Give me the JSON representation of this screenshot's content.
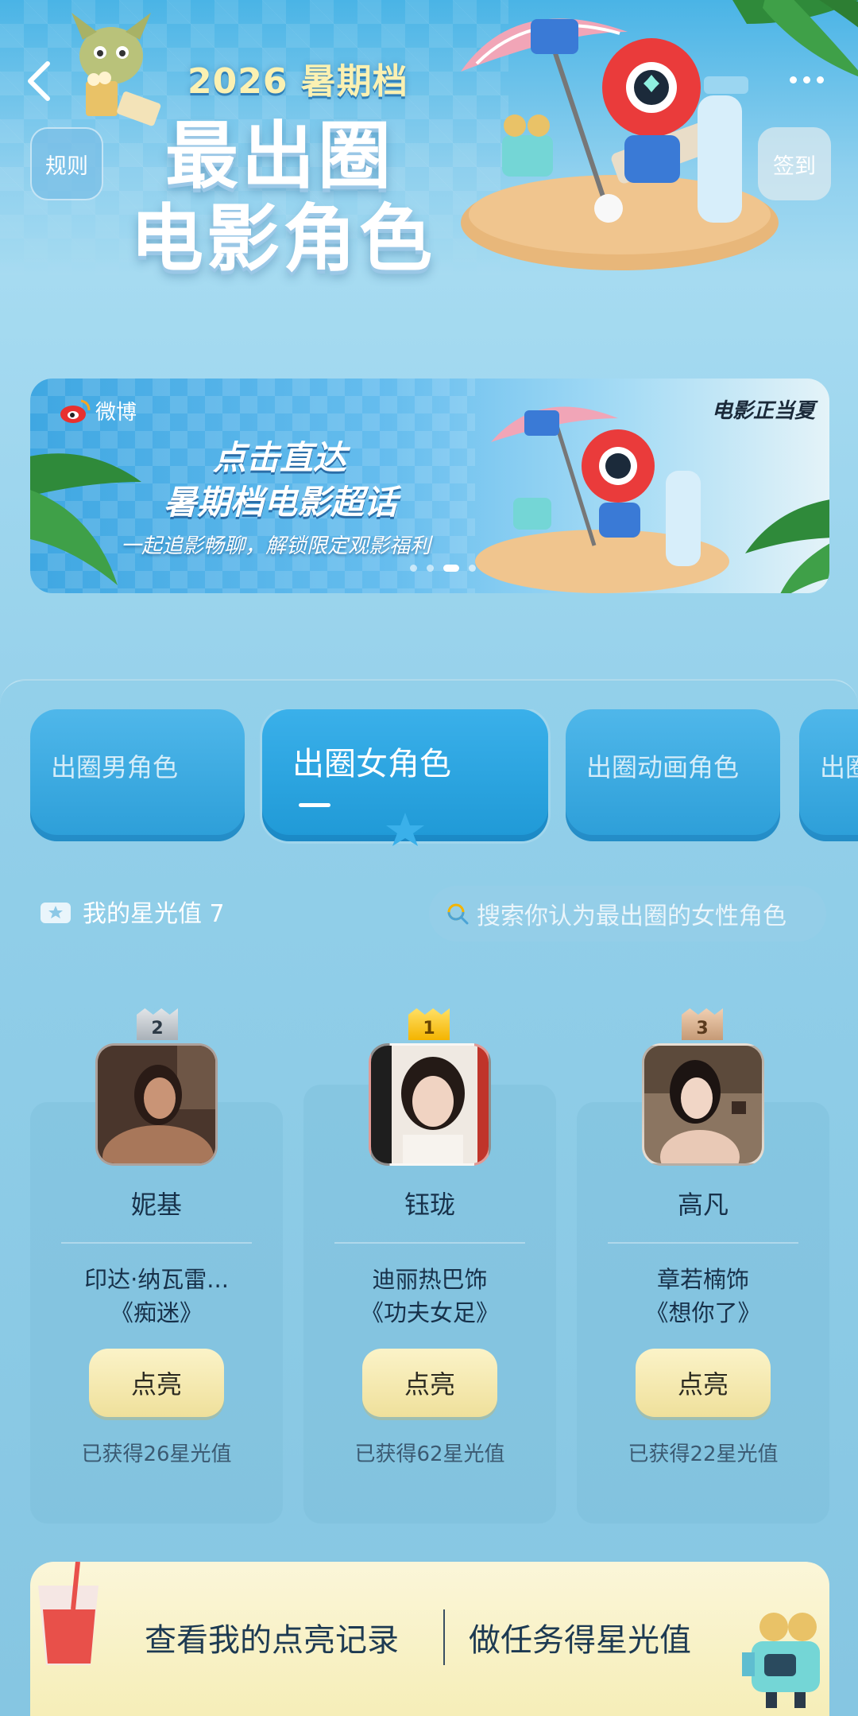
{
  "hero": {
    "year": "2026 暑期档",
    "title_line1": "最出圈",
    "title_line2": "电影角色",
    "rules_label": "规则",
    "checkin_label": "签到"
  },
  "banner": {
    "brand": "微博",
    "line1": "点击直达",
    "line2": "暑期档电影超话",
    "slogan": "一起追影畅聊，解锁限定观影福利",
    "brand_right": "电影正当夏",
    "dots": 4,
    "active_dot": 3
  },
  "tabs": [
    {
      "label": "出圈男角色"
    },
    {
      "label": "出圈女角色",
      "active": true
    },
    {
      "label": "出圈动画角色"
    },
    {
      "label": "出圈"
    }
  ],
  "my_star": {
    "label": "我的星光值 7"
  },
  "search": {
    "placeholder": "搜索你认为最出圈的女性角色"
  },
  "characters": [
    {
      "rank": "2",
      "name": "妮基",
      "actor": "印达·纳瓦雷...",
      "film": "《痴迷》",
      "button": "点亮",
      "earned": "已获得26星光值"
    },
    {
      "rank": "1",
      "name": "钰珑",
      "actor": "迪丽热巴饰",
      "film": "《功夫女足》",
      "button": "点亮",
      "earned": "已获得62星光值"
    },
    {
      "rank": "3",
      "name": "高凡",
      "actor": "章若楠饰",
      "film": "《想你了》",
      "button": "点亮",
      "earned": "已获得22星光值"
    }
  ],
  "bottom": {
    "left": "查看我的点亮记录",
    "right": "做任务得星光值"
  },
  "colors": {
    "accent_blue": "#1f99d6",
    "button_yellow": "#efe09b",
    "gold": "#f4b400"
  }
}
